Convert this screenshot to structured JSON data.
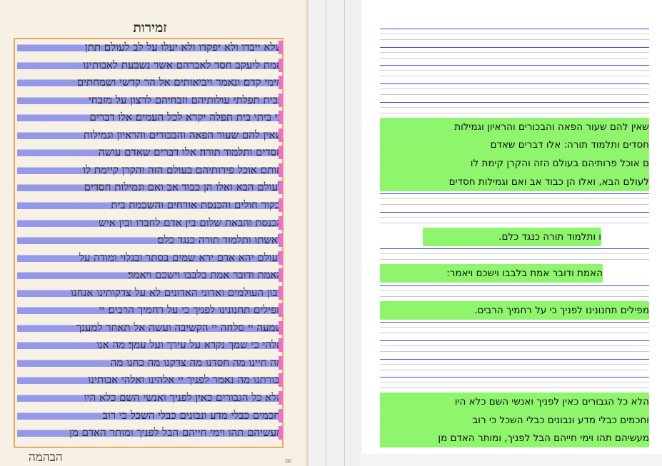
{
  "manuscript": {
    "header": "זמירות",
    "footer": "הבהמה",
    "lines": [
      "שלא ייבדו ולא יפקדו ולא יעלו על לב לעולם׃ תתן",
      "אמת ליעקב חסד לאברהם אשר נשבעת לאבותינו",
      "מימי קדם׃ ונאמר ויביאותים אל הר קדשי ושמחתים",
      "בבית תפלתי עולותיהם וזבחיהם לרצון על מזבחי",
      "כי ביתי בית תפלה יקרא לכל העמים׃ אלו דברים",
      "שאין להם שעור הפאה והבכורים והראיון וגמילות",
      "חסדים ותלמוד תורה׃ אלו דברים שאדם עושה",
      "אותם אוכל פירותיהם בעולם הזה והקרן קיימת לו",
      "לעולם הבא ואלו הן כבוד אב ואם וגמילות חסדים",
      "ובקור חולים והכנסת אורחים והשכמת בית",
      "הכנסת והבאת שלום בין אדם לחברו ובין איש",
      "לאשתו ותלמוד תורה כנגד כלם׃",
      "לעולם יהא אדם ירא שמים בסתר ובגלוי ומודה על",
      "האמת ודובר אמת בלבבו וישכם ויאמר׃",
      "רבון העולמים ואדוני האדונים לא על צדקותינו אנחנו",
      "מפילים תחנונינו לפניך כי על רחמיך הרבים׃ יי",
      "שמעה יי סלחה יי הקשיבה ועשה אל תאחר למענך",
      "אלהי כי שמך נקרא על עירך ועל עמך׃ מה אנו",
      "מה חיינו מה חסדנו מה צדקנו מה כחנו מה",
      "גבורתנו מה נאמר לפניך יי אלהינו ואלהי אבותינו",
      "הלא כל הגבורים כאין לפניך ואנשי השם כלא היו",
      "וחכמים כבלי מדע ונבונים כבלי השכל כי רוב",
      "מעשיהם תהו וימי חייהם הבל לפניך ומותר האדם מן"
    ]
  },
  "transcription": {
    "lines": [
      "",
      "",
      "",
      "",
      "",
      "שאין להם שעור הפאה והבכורים והראיון וגמילות",
      "חסדים ותלמוד תורה: אלו דברים שאדם",
      "ם אוכל פרותיהם בעולם הזה והקרן קימת לו",
      "לעולם הבא, ואלו הן כבוד אב ואם וגמילות חסדים",
      "",
      "",
      "ו ותלמוד תורה כנגד כלם.",
      "",
      "האמת ודובר אמת בלבבו וישכם ויאמר:",
      "",
      "מפילים תחנונינו לפניך כי על רחמיך הרבים.",
      "",
      "",
      "",
      "",
      "הלא כל הגבורים כאין לפניך ואנשי השם כלא היו",
      "וחכמים כבלי מדע ונבונים כבלי השכל כי רוב",
      "מעשיהם תהו וימי חייהם הבל לפניך, ומותר האדם מן"
    ]
  },
  "colors": {
    "line_highlight": "#4650eb",
    "margin_mark": "#ee6fd0",
    "frame": "#f0a860",
    "matched_line": "#8ef56d",
    "baseline": "#3a50d6"
  },
  "icons": {
    "corner": "link-icon"
  }
}
